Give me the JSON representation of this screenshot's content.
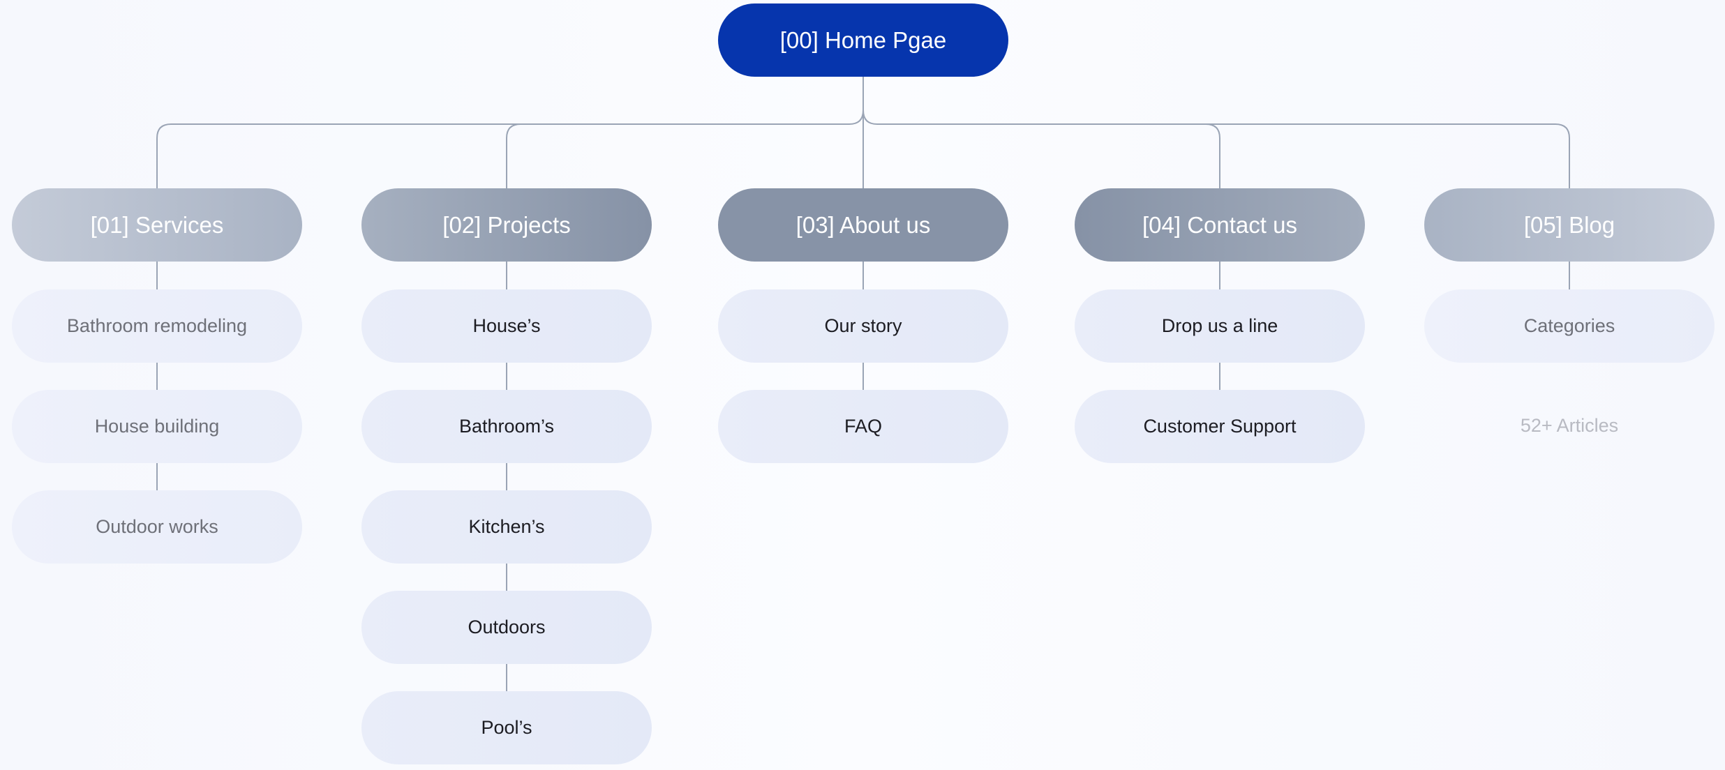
{
  "root": {
    "label": "[00] Home Pgae",
    "color": "#0635AD"
  },
  "sections": [
    {
      "label": "[01] Services",
      "children": [
        "Bathroom remodeling",
        "House building",
        "Outdoor works"
      ],
      "muted": true
    },
    {
      "label": "[02] Projects",
      "children": [
        "House’s",
        "Bathroom’s",
        "Kitchen’s",
        "Outdoors",
        "Pool’s"
      ],
      "muted": false
    },
    {
      "label": "[03] About us",
      "children": [
        "Our story",
        "FAQ"
      ],
      "muted": false
    },
    {
      "label": "[04] Contact us",
      "children": [
        "Drop us a line",
        "Customer Support"
      ],
      "muted": false
    },
    {
      "label": "[05] Blog",
      "children": [
        "Categories"
      ],
      "note": "52+ Articles",
      "muted": true
    }
  ],
  "colors": {
    "connector": "#9aa4b5",
    "child_text": "#1c1c22",
    "muted_text": "#6e7078",
    "note_text": "#b8bac2"
  }
}
